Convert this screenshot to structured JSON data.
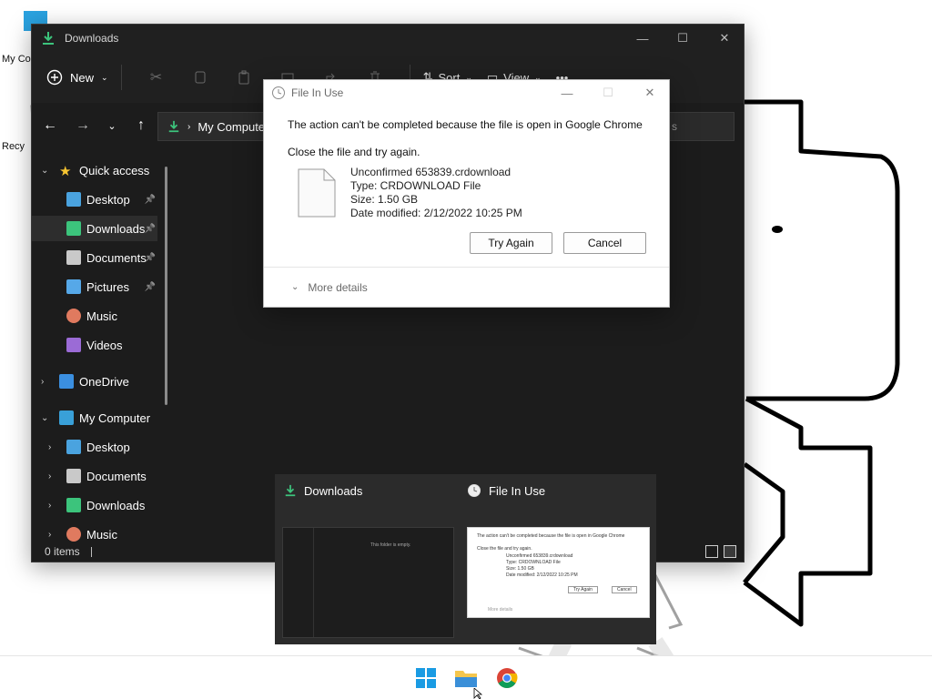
{
  "desktop": {
    "icons": [
      {
        "label": "My Co",
        "icon": "computer-icon"
      },
      {
        "label": "Recy",
        "icon": "recycle-bin-icon"
      }
    ]
  },
  "explorer": {
    "title": "Downloads",
    "toolbar": {
      "new_label": "New",
      "sort_label": "Sort",
      "view_label": "View",
      "more_label": "•••"
    },
    "address": {
      "segment": "My Computer",
      "search_placeholder": "s"
    },
    "sidebar": {
      "items": [
        {
          "label": "Quick access",
          "icon": "star-icon",
          "chevron": "down"
        },
        {
          "label": "Desktop",
          "icon": "desktop-folder-icon",
          "pinned": true
        },
        {
          "label": "Downloads",
          "icon": "downloads-icon",
          "pinned": true,
          "selected": true
        },
        {
          "label": "Documents",
          "icon": "documents-icon",
          "pinned": true
        },
        {
          "label": "Pictures",
          "icon": "pictures-icon",
          "pinned": true
        },
        {
          "label": "Music",
          "icon": "music-icon"
        },
        {
          "label": "Videos",
          "icon": "videos-icon"
        },
        {
          "label": "OneDrive",
          "icon": "cloud-icon",
          "chevron": "right"
        },
        {
          "label": "My Computer",
          "icon": "computer-icon",
          "chevron": "down"
        },
        {
          "label": "Desktop",
          "icon": "desktop-folder-icon",
          "chevron": "right"
        },
        {
          "label": "Documents",
          "icon": "documents-icon",
          "chevron": "right"
        },
        {
          "label": "Downloads",
          "icon": "downloads-icon",
          "chevron": "right"
        },
        {
          "label": "Music",
          "icon": "music-icon",
          "chevron": "right"
        }
      ]
    },
    "status": {
      "items_count": "0 items"
    }
  },
  "dialog": {
    "title": "File In Use",
    "message": "The action can't be completed because the file is open in Google Chrome",
    "instruction": "Close the file and try again.",
    "file": {
      "name": "Unconfirmed 653839.crdownload",
      "type": "Type: CRDOWNLOAD File",
      "size": "Size: 1.50 GB",
      "modified": "Date modified: 2/12/2022 10:25 PM"
    },
    "try_again_label": "Try Again",
    "cancel_label": "Cancel",
    "more_details_label": "More details"
  },
  "switcher": {
    "window1_title": "Downloads",
    "window2_title": "File In Use",
    "thumb1_empty_text": "This folder is empty."
  },
  "taskbar": {
    "apps": [
      "start-icon",
      "file-explorer-icon",
      "chrome-icon"
    ]
  }
}
